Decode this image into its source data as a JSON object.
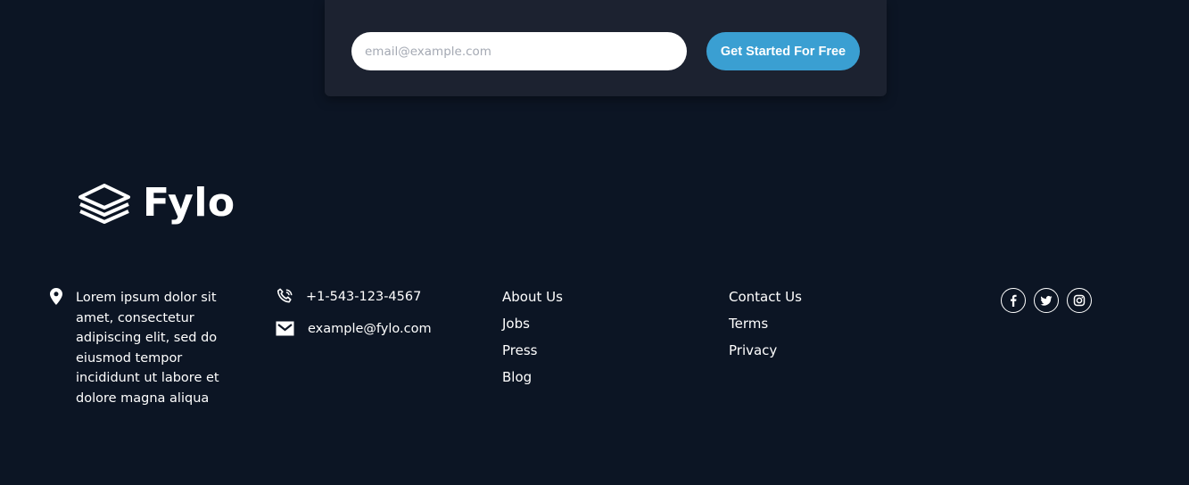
{
  "signup": {
    "email_placeholder": "email@example.com",
    "email_value": "",
    "cta_label": "Get Started For Free"
  },
  "brand": {
    "name": "Fylo",
    "logo_icon": "stacked-layers-icon"
  },
  "footer": {
    "address": {
      "icon": "location-pin-icon",
      "text": "Lorem ipsum dolor sit amet, consectetur adipiscing elit, sed do eiusmod tempor incididunt ut labore et dolore magna aliqua"
    },
    "phone": {
      "icon": "phone-icon",
      "text": "+1-543-123-4567"
    },
    "email": {
      "icon": "envelope-icon",
      "text": "example@fylo.com"
    },
    "links_col1": [
      "About Us",
      "Jobs",
      "Press",
      "Blog"
    ],
    "links_col2": [
      "Contact Us",
      "Terms",
      "Privacy"
    ],
    "social": [
      "facebook-icon",
      "twitter-icon",
      "instagram-icon"
    ]
  },
  "colors": {
    "background": "#0c1524",
    "card": "#1c2230",
    "accent": "#3a9fd2",
    "text": "#ffffff"
  }
}
